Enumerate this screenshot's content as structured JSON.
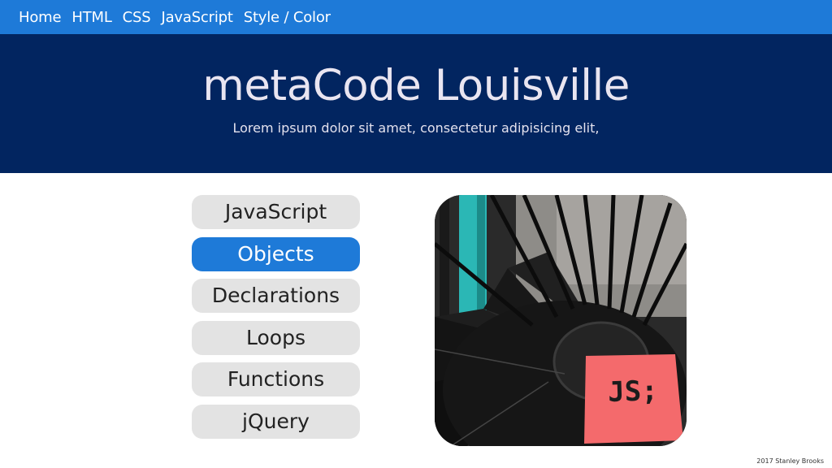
{
  "nav": {
    "links": [
      "Home",
      "HTML",
      "CSS",
      "JavaScript",
      "Style / Color"
    ]
  },
  "hero": {
    "title": "metaCode Louisville",
    "subtitle": "Lorem ipsum dolor sit amet, consectetur adipisicing elit,"
  },
  "menu": {
    "items": [
      "JavaScript",
      "Objects",
      "Declarations",
      "Loops",
      "Functions",
      "jQuery"
    ],
    "active": "Objects"
  },
  "photo": {
    "sticky_note_text": "JS;"
  },
  "footer": {
    "credit": "2017 Stanley Brooks"
  },
  "colors": {
    "nav_bar": "#1e7ad8",
    "hero_background": "#022560",
    "button_default": "#e3e3e3",
    "button_active": "#1e7ad8",
    "sticky_note": "#f46a6c"
  }
}
